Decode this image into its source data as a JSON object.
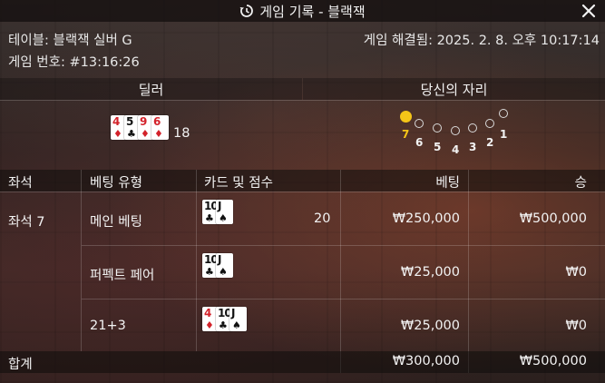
{
  "header": {
    "title": "게임 기록 - 블랙잭",
    "icons": {
      "history": "history-icon",
      "close": "close-icon"
    }
  },
  "info": {
    "table": "테이블: 블랙잭 실버 G",
    "game_number": "게임 번호: #13:16:26",
    "resolved": "게임 해결됨: 2025. 2. 8. 오후 10:17:14"
  },
  "dealer": {
    "label": "딜러",
    "cards": [
      {
        "rank": "4",
        "suit": "♦",
        "color": "red"
      },
      {
        "rank": "5",
        "suit": "♣",
        "color": "black"
      },
      {
        "rank": "9",
        "suit": "♦",
        "color": "red"
      },
      {
        "rank": "6",
        "suit": "♦",
        "color": "red"
      }
    ],
    "score": "18"
  },
  "seats": {
    "label": "당신의 자리",
    "numbers": [
      "7",
      "6",
      "5",
      "4",
      "3",
      "2",
      "1"
    ],
    "active": "7",
    "active_color": "#f5c518"
  },
  "table": {
    "headers": {
      "seat": "좌석",
      "bet_type": "베팅 유형",
      "cards": "카드 및 점수",
      "bet": "베팅",
      "win": "승"
    },
    "seat_label": "좌석 7",
    "rows": [
      {
        "bet_type": "메인 베팅",
        "cards": [
          {
            "rank": "10",
            "suit": "♣",
            "color": "black"
          },
          {
            "rank": "J",
            "suit": "♠",
            "color": "black"
          }
        ],
        "score": "20",
        "bet": "₩250,000",
        "win": "₩500,000"
      },
      {
        "bet_type": "퍼펙트 페어",
        "cards": [
          {
            "rank": "10",
            "suit": "♣",
            "color": "black"
          },
          {
            "rank": "J",
            "suit": "♠",
            "color": "black"
          }
        ],
        "score": "",
        "bet": "₩25,000",
        "win": "₩0"
      },
      {
        "bet_type": "21+3",
        "cards": [
          {
            "rank": "4",
            "suit": "♦",
            "color": "red"
          },
          {
            "rank": "10",
            "suit": "♣",
            "color": "black"
          },
          {
            "rank": "J",
            "suit": "♠",
            "color": "black"
          }
        ],
        "score": "",
        "bet": "₩25,000",
        "win": "₩0"
      }
    ],
    "total": {
      "label": "합계",
      "bet": "₩300,000",
      "win": "₩500,000"
    }
  }
}
